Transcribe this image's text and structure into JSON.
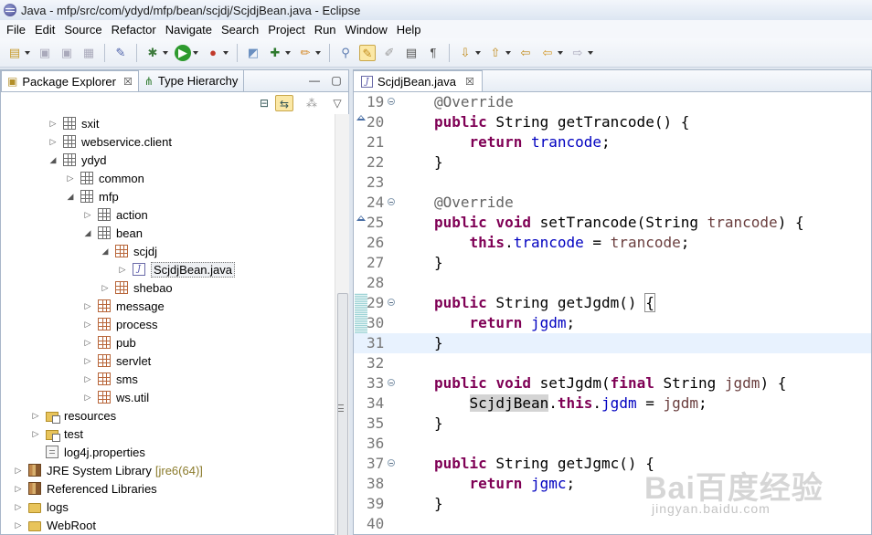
{
  "window": {
    "title": "Java - mfp/src/com/ydyd/mfp/bean/scjdj/ScjdjBean.java - Eclipse"
  },
  "menu": [
    "File",
    "Edit",
    "Source",
    "Refactor",
    "Navigate",
    "Search",
    "Project",
    "Run",
    "Window",
    "Help"
  ],
  "toolbar": {
    "icons": [
      "new-icon",
      "save-icon",
      "save-all-icon",
      "print-icon",
      "pin-icon",
      "debug-icon",
      "run-icon",
      "external-tools-icon",
      "new-java-project-icon",
      "new-package-icon",
      "open-type-icon",
      "search-icon",
      "toggle-mark-occurrences-icon",
      "highlight-icon",
      "show-whitespace-icon",
      "block-selection-icon",
      "next-annotation-icon",
      "previous-annotation-icon",
      "last-edit-location-icon",
      "back-icon",
      "forward-icon"
    ]
  },
  "left_panel": {
    "tabs": [
      {
        "label": "Package Explorer",
        "close": "☒"
      },
      {
        "label": "Type Hierarchy"
      }
    ],
    "tree": [
      {
        "label": "sxit",
        "depth": 3,
        "icon": "package",
        "twisty": "▷"
      },
      {
        "label": "webservice.client",
        "depth": 3,
        "icon": "package",
        "twisty": "▷"
      },
      {
        "label": "ydyd",
        "depth": 3,
        "icon": "package",
        "twisty": "◢"
      },
      {
        "label": "common",
        "depth": 4,
        "icon": "package",
        "twisty": "▷"
      },
      {
        "label": "mfp",
        "depth": 4,
        "icon": "package",
        "twisty": "◢"
      },
      {
        "label": "action",
        "depth": 5,
        "icon": "package",
        "twisty": "▷"
      },
      {
        "label": "bean",
        "depth": 5,
        "icon": "package",
        "twisty": "◢"
      },
      {
        "label": "scjdj",
        "depth": 6,
        "icon": "package-orange",
        "twisty": "◢"
      },
      {
        "label": "ScjdjBean.java",
        "depth": 7,
        "icon": "java-file",
        "twisty": "▷",
        "selected": true
      },
      {
        "label": "shebao",
        "depth": 6,
        "icon": "package-orange",
        "twisty": "▷"
      },
      {
        "label": "message",
        "depth": 5,
        "icon": "package-orange",
        "twisty": "▷"
      },
      {
        "label": "process",
        "depth": 5,
        "icon": "package-orange",
        "twisty": "▷"
      },
      {
        "label": "pub",
        "depth": 5,
        "icon": "package-orange",
        "twisty": "▷"
      },
      {
        "label": "servlet",
        "depth": 5,
        "icon": "package-orange",
        "twisty": "▷"
      },
      {
        "label": "sms",
        "depth": 5,
        "icon": "package-orange",
        "twisty": "▷"
      },
      {
        "label": "ws.util",
        "depth": 5,
        "icon": "package-orange",
        "twisty": "▷"
      },
      {
        "label": "resources",
        "depth": 2,
        "icon": "source-folder",
        "twisty": "▷"
      },
      {
        "label": "test",
        "depth": 2,
        "icon": "source-folder",
        "twisty": "▷"
      },
      {
        "label": "log4j.properties",
        "depth": 2,
        "icon": "properties-file",
        "twisty": ""
      },
      {
        "label": "JRE System Library",
        "suffix": "[jre6(64)]",
        "depth": 1,
        "icon": "library",
        "twisty": "▷"
      },
      {
        "label": "Referenced Libraries",
        "depth": 1,
        "icon": "library",
        "twisty": "▷"
      },
      {
        "label": "logs",
        "depth": 1,
        "icon": "folder",
        "twisty": "▷"
      },
      {
        "label": "WebRoot",
        "depth": 1,
        "icon": "folder",
        "twisty": "▷"
      }
    ]
  },
  "editor": {
    "tab_label": "ScjdjBean.java",
    "tab_close": "☒",
    "current_line": 31,
    "lines": [
      {
        "n": "19",
        "fold": true,
        "code": "    @Override"
      },
      {
        "n": "20",
        "override": true,
        "code": "    public String getTrancode() {"
      },
      {
        "n": "21",
        "code": "        return trancode;"
      },
      {
        "n": "22",
        "code": "    }"
      },
      {
        "n": "23",
        "code": ""
      },
      {
        "n": "24",
        "fold": true,
        "code": "    @Override"
      },
      {
        "n": "25",
        "override": true,
        "code": "    public void setTrancode(String trancode) {"
      },
      {
        "n": "26",
        "code": "        this.trancode = trancode;"
      },
      {
        "n": "27",
        "code": "    }"
      },
      {
        "n": "28",
        "code": ""
      },
      {
        "n": "29",
        "fold": true,
        "code": "    public String getJgdm() {"
      },
      {
        "n": "30",
        "code": "        return jgdm;"
      },
      {
        "n": "31",
        "code": "    }"
      },
      {
        "n": "32",
        "code": ""
      },
      {
        "n": "33",
        "fold": true,
        "code": "    public void setJgdm(final String jgdm) {"
      },
      {
        "n": "34",
        "code": "        ScjdjBean.this.jgdm = jgdm;"
      },
      {
        "n": "35",
        "code": "    }"
      },
      {
        "n": "36",
        "code": ""
      },
      {
        "n": "37",
        "fold": true,
        "code": "    public String getJgmc() {"
      },
      {
        "n": "38",
        "code": "        return jgmc;"
      },
      {
        "n": "39",
        "code": "    }"
      },
      {
        "n": "40",
        "code": ""
      }
    ]
  },
  "watermark": {
    "logo": "Bai百度经验",
    "sub": "jingyan.baidu.com"
  }
}
